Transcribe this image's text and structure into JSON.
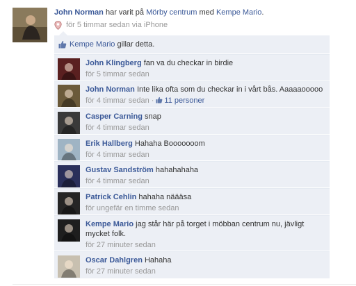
{
  "story": {
    "author": "John Norman",
    "action_text": "har varit på",
    "place": "Mörby centrum",
    "with_text": "med",
    "tagged": "Kempe Mario",
    "time_text": "för 5 timmar sedan via iPhone"
  },
  "likes": {
    "liker": "Kempe Mario",
    "text": "gillar detta."
  },
  "comments": [
    {
      "author": "John Klingberg",
      "text": "fan va du checkar in birdie",
      "time": "för 5 timmar sedan",
      "avatar_color": "#5a2020"
    },
    {
      "author": "John Norman",
      "text": "Inte lika ofta som du checkar in i vårt bås. Aaaaaooooo",
      "time": "för 4 timmar sedan",
      "likes_label": "11 personer",
      "avatar_color": "#6b5a3a"
    },
    {
      "author": "Casper Carning",
      "text": "snap",
      "time": "för 4 timmar sedan",
      "avatar_color": "#3a3a3a"
    },
    {
      "author": "Erik Hallberg",
      "text": "Hahaha Booooooom",
      "time": "för 4 timmar sedan",
      "avatar_color": "#9fb4c4"
    },
    {
      "author": "Gustav Sandström",
      "text": "hahahahaha",
      "time": "för 4 timmar sedan",
      "avatar_color": "#2a2f5a"
    },
    {
      "author": "Patrick Cehlin",
      "text": "hahaha näääsa",
      "time": "för ungefär en timme sedan",
      "avatar_color": "#252525"
    },
    {
      "author": "Kempe Mario",
      "text": "jag står här på torget i möbban centrum nu, jävligt mycket folk.",
      "time": "för 27 minuter sedan",
      "avatar_color": "#1e1e1e"
    },
    {
      "author": "Oscar Dahlgren",
      "text": "Hahaha",
      "time": "för 27 minuter sedan",
      "avatar_color": "#c8c0b0"
    }
  ],
  "colors": {
    "link": "#3b5998",
    "ufi_bg": "#eceff5",
    "meta_text": "#999999"
  }
}
